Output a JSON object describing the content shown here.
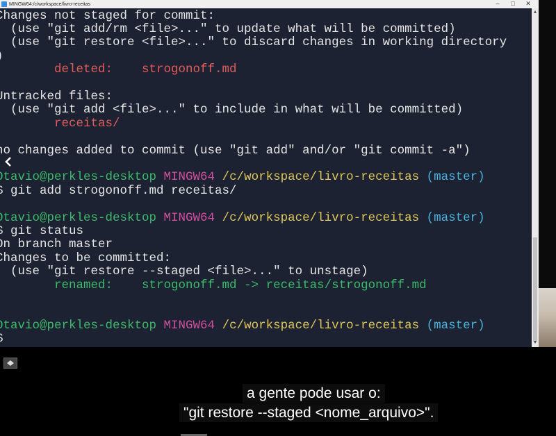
{
  "window": {
    "title": "MINGW64:/c/workspace/livro-receitas",
    "minimize": "–",
    "maximize": "□",
    "close": "✕"
  },
  "terminal": {
    "lines": [
      {
        "segments": [
          {
            "text": "Changes not staged for commit:",
            "color": "white"
          }
        ]
      },
      {
        "segments": [
          {
            "text": "  (use \"git add/rm <file>...\" to update what will be committed)",
            "color": "white"
          }
        ]
      },
      {
        "segments": [
          {
            "text": "  (use \"git restore <file>...\" to discard changes in working directory",
            "color": "white"
          }
        ]
      },
      {
        "segments": [
          {
            "text": ")",
            "color": "white"
          }
        ]
      },
      {
        "segments": [
          {
            "text": "        deleted:    strogonoff.md",
            "color": "red"
          }
        ]
      },
      {
        "segments": [
          {
            "text": "",
            "color": "white"
          }
        ]
      },
      {
        "segments": [
          {
            "text": "Untracked files:",
            "color": "white"
          }
        ]
      },
      {
        "segments": [
          {
            "text": "  (use \"git add <file>...\" to include in what will be committed)",
            "color": "white"
          }
        ]
      },
      {
        "segments": [
          {
            "text": "        receitas/",
            "color": "red"
          }
        ]
      },
      {
        "segments": [
          {
            "text": "",
            "color": "white"
          }
        ]
      },
      {
        "segments": [
          {
            "text": "no changes added to commit (use \"git add\" and/or \"git commit -a\")",
            "color": "white"
          }
        ]
      },
      {
        "segments": [
          {
            "text": "",
            "color": "white"
          }
        ]
      },
      {
        "segments": [
          {
            "text": "Otavio@perkles-desktop ",
            "color": "green"
          },
          {
            "text": "MINGW64 ",
            "color": "pink"
          },
          {
            "text": "/c/workspace/livro-receitas ",
            "color": "yellow"
          },
          {
            "text": "(master)",
            "color": "cyan"
          }
        ]
      },
      {
        "segments": [
          {
            "text": "$ git add strogonoff.md receitas/",
            "color": "white"
          }
        ]
      },
      {
        "segments": [
          {
            "text": "",
            "color": "white"
          }
        ]
      },
      {
        "segments": [
          {
            "text": "Otavio@perkles-desktop ",
            "color": "green"
          },
          {
            "text": "MINGW64 ",
            "color": "pink"
          },
          {
            "text": "/c/workspace/livro-receitas ",
            "color": "yellow"
          },
          {
            "text": "(master)",
            "color": "cyan"
          }
        ]
      },
      {
        "segments": [
          {
            "text": "$ git status",
            "color": "white"
          }
        ]
      },
      {
        "segments": [
          {
            "text": "On branch master",
            "color": "white"
          }
        ]
      },
      {
        "segments": [
          {
            "text": "Changes to be committed:",
            "color": "white"
          }
        ]
      },
      {
        "segments": [
          {
            "text": "  (use \"git restore --staged <file>...\" to unstage)",
            "color": "white"
          }
        ]
      },
      {
        "segments": [
          {
            "text": "        renamed:    strogonoff.md -> receitas/strogonoff.md",
            "color": "green"
          }
        ]
      },
      {
        "segments": [
          {
            "text": "",
            "color": "white"
          }
        ]
      },
      {
        "segments": [
          {
            "text": "",
            "color": "white"
          }
        ]
      },
      {
        "segments": [
          {
            "text": "Otavio@perkles-desktop ",
            "color": "green"
          },
          {
            "text": "MINGW64 ",
            "color": "pink"
          },
          {
            "text": "/c/workspace/livro-receitas ",
            "color": "yellow"
          },
          {
            "text": "(master)",
            "color": "cyan"
          }
        ]
      },
      {
        "segments": [
          {
            "text": "$",
            "color": "white"
          }
        ]
      }
    ]
  },
  "captions": {
    "line1": "a gente pode usar o:",
    "line2": "\"git restore --staged <nome_arquivo>\"."
  },
  "colors": {
    "terminal_bg": "#1c2231",
    "red": "#e35b5b",
    "green": "#3dba6b",
    "pink": "#d14fa0",
    "yellow": "#e0c85a",
    "cyan": "#4ab4df"
  },
  "icons": {
    "app": "git-bash-icon",
    "back": "chevron-left-icon",
    "player": "expand-icon"
  }
}
